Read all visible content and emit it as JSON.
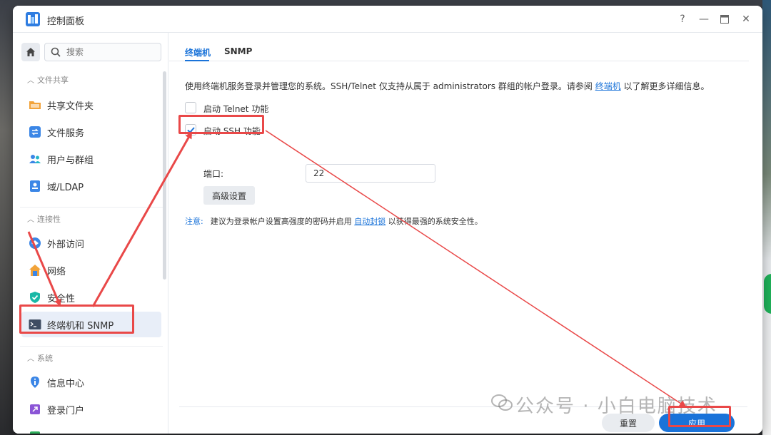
{
  "window": {
    "title": "控制面板"
  },
  "title_controls": {
    "help": "?",
    "minimize": "—",
    "maximize": "▭",
    "close": "✕"
  },
  "sidebar": {
    "search_placeholder": "搜索",
    "sections": [
      {
        "label": "文件共享",
        "items": [
          "共享文件夹",
          "文件服务",
          "用户与群组",
          "域/LDAP"
        ]
      },
      {
        "label": "连接性",
        "items": [
          "外部访问",
          "网络",
          "安全性",
          "终端机和 SNMP"
        ]
      },
      {
        "label": "系统",
        "items": [
          "信息中心",
          "登录门户"
        ]
      }
    ],
    "active_item": "终端机和 SNMP"
  },
  "tabs": [
    {
      "label": "终端机",
      "active": true
    },
    {
      "label": "SNMP",
      "active": false
    }
  ],
  "content": {
    "description_before": "使用终端机服务登录并管理您的系统。SSH/Telnet 仅支持从属于 administrators 群组的帐户登录。请参阅 ",
    "description_link": "终端机",
    "description_after": " 以了解更多详细信息。",
    "telnet_label": "启动 Telnet 功能",
    "telnet_checked": false,
    "ssh_label": "启动 SSH 功能",
    "ssh_checked": true,
    "port_label": "端口:",
    "port_value": "22",
    "advanced_button": "高级设置",
    "note_tag": "注意:",
    "note_before": "建议为登录帐户设置高强度的密码并启用 ",
    "note_link": "自动封锁",
    "note_after": " 以获得最强的系统安全性。"
  },
  "footer": {
    "reset_label": "重置",
    "apply_label": "应用"
  },
  "watermark": "公众号 · 小白电脑技术",
  "colors": {
    "accent": "#1a73d9",
    "highlight": "#e94848"
  }
}
